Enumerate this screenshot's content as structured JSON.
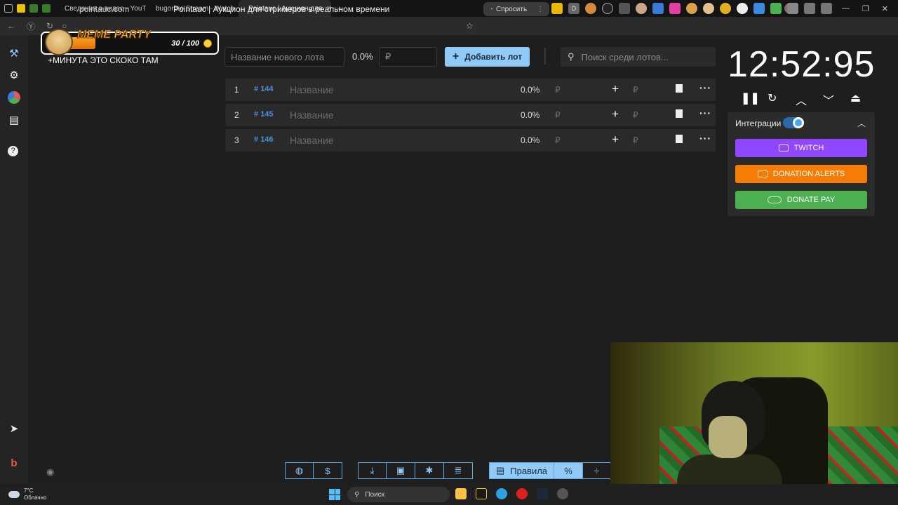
{
  "browser": {
    "tabs": [
      {
        "label": "Сведения о видео - YouT",
        "active": false
      },
      {
        "label": "bugorbro Stream - Watch",
        "active": false
      },
      {
        "label": "Pointauc | Аукцион для",
        "active": true
      }
    ],
    "url": "pointauc.com",
    "page_title": "Pointauc | Аукцион для стримеров в реальном времени",
    "ask_label": "Спросить"
  },
  "overlay": {
    "title": "MEME PARTY",
    "count": "30 / 100",
    "caption": "+МИНУТА ЭТО СКОКО ТАМ"
  },
  "toolbar": {
    "new_lot_placeholder": "Название нового лота",
    "percent": "0.0%",
    "amount_placeholder": "₽",
    "add_label": "Добавить лот",
    "search_placeholder": "Поиск среди лотов..."
  },
  "lots": [
    {
      "index": "1",
      "id": "144",
      "name": "Название",
      "percent": "0.0%",
      "currency": "₽"
    },
    {
      "index": "2",
      "id": "145",
      "name": "Название",
      "percent": "0.0%",
      "currency": "₽"
    },
    {
      "index": "3",
      "id": "146",
      "name": "Название",
      "percent": "0.0%",
      "currency": "₽"
    }
  ],
  "timer": {
    "value": "12:52:95"
  },
  "integrations": {
    "label": "Интеграции",
    "enabled": true,
    "buttons": [
      {
        "label": "TWITCH",
        "color": "#9146ff"
      },
      {
        "label": "DONATION ALERTS",
        "color": "#f57d07"
      },
      {
        "label": "DONATE PAY",
        "color": "#4caf50"
      }
    ]
  },
  "bottom": {
    "rules_label": "Правила"
  },
  "taskbar": {
    "temp": "7°C",
    "weather": "Облачно",
    "search": "Поиск"
  },
  "colors": {
    "accent": "#90caf9",
    "id": "#4a90d9",
    "background": "#1e1e1e"
  }
}
